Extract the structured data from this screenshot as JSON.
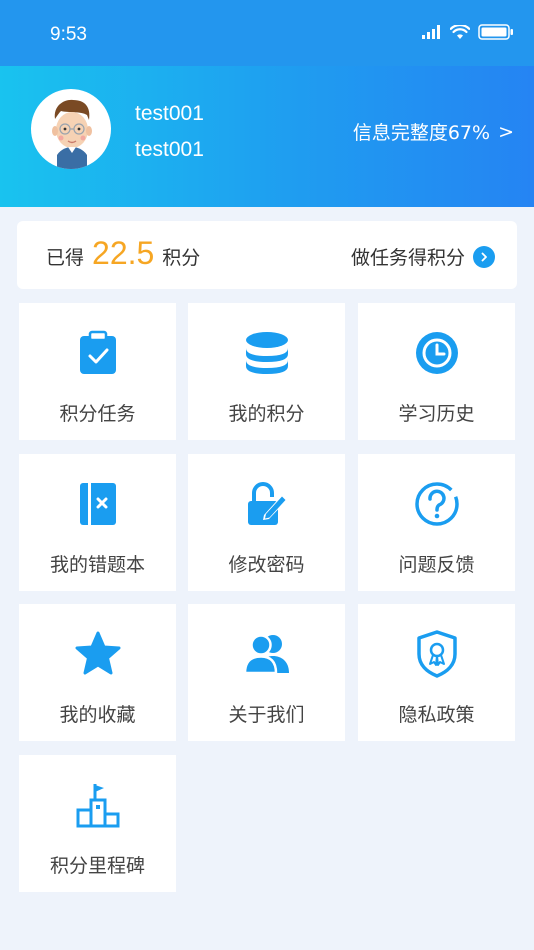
{
  "status_bar": {
    "time": "9:53"
  },
  "profile": {
    "name": "test001",
    "account": "test001",
    "completeness": "信息完整度67%",
    "chevron": ">"
  },
  "points": {
    "prefix": "已得",
    "value": "22.5",
    "unit": "积分",
    "task_link": "做任务得积分"
  },
  "menu": [
    {
      "label": "积分任务",
      "icon": "clipboard-check-icon"
    },
    {
      "label": "我的积分",
      "icon": "coin-stack-icon"
    },
    {
      "label": "学习历史",
      "icon": "clock-icon"
    },
    {
      "label": "我的错题本",
      "icon": "notebook-x-icon"
    },
    {
      "label": "修改密码",
      "icon": "lock-edit-icon"
    },
    {
      "label": "问题反馈",
      "icon": "question-circle-icon"
    },
    {
      "label": "我的收藏",
      "icon": "star-icon"
    },
    {
      "label": "关于我们",
      "icon": "users-icon"
    },
    {
      "label": "隐私政策",
      "icon": "shield-badge-icon"
    },
    {
      "label": "积分里程碑",
      "icon": "podium-flag-icon"
    }
  ],
  "colors": {
    "accent": "#1a9df0",
    "points_value": "#f6a623",
    "status_bar": "#2396ee"
  }
}
